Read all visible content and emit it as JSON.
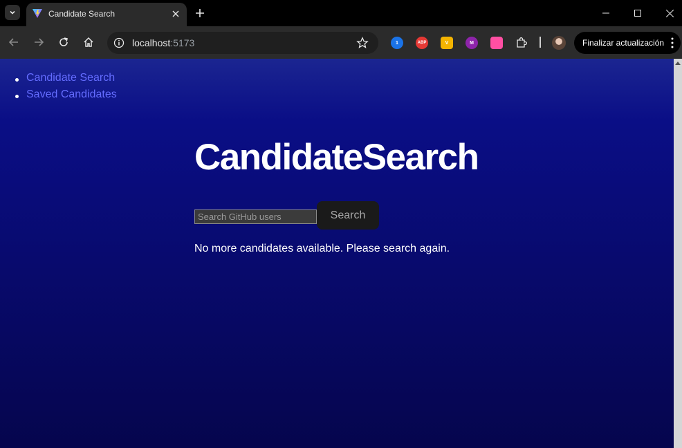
{
  "browser": {
    "tab": {
      "title": "Candidate Search"
    },
    "address": {
      "host": "localhost",
      "port": ":5173"
    },
    "update_button": "Finalizar actualización",
    "extensions": [
      {
        "name": "1password",
        "label": "1",
        "color": "#1a73e8"
      },
      {
        "name": "adblock",
        "label": "ABP",
        "color": "#e53935"
      },
      {
        "name": "vpn-shield",
        "label": "V",
        "color": "#f4b400"
      },
      {
        "name": "mercado",
        "label": "M",
        "color": "#8e24aa"
      },
      {
        "name": "video-recorder",
        "label": "",
        "color": "#ff4fa3"
      }
    ]
  },
  "page": {
    "nav": [
      {
        "label": "Candidate Search"
      },
      {
        "label": "Saved Candidates"
      }
    ],
    "heading": "CandidateSearch",
    "search": {
      "placeholder": "Search GitHub users",
      "value": "",
      "button_label": "Search"
    },
    "message": "No more candidates available. Please search again."
  },
  "colors": {
    "link": "#646cff",
    "background_top": "#1b2591",
    "background_bottom": "#05054d",
    "button_bg": "#1a1a1a"
  }
}
